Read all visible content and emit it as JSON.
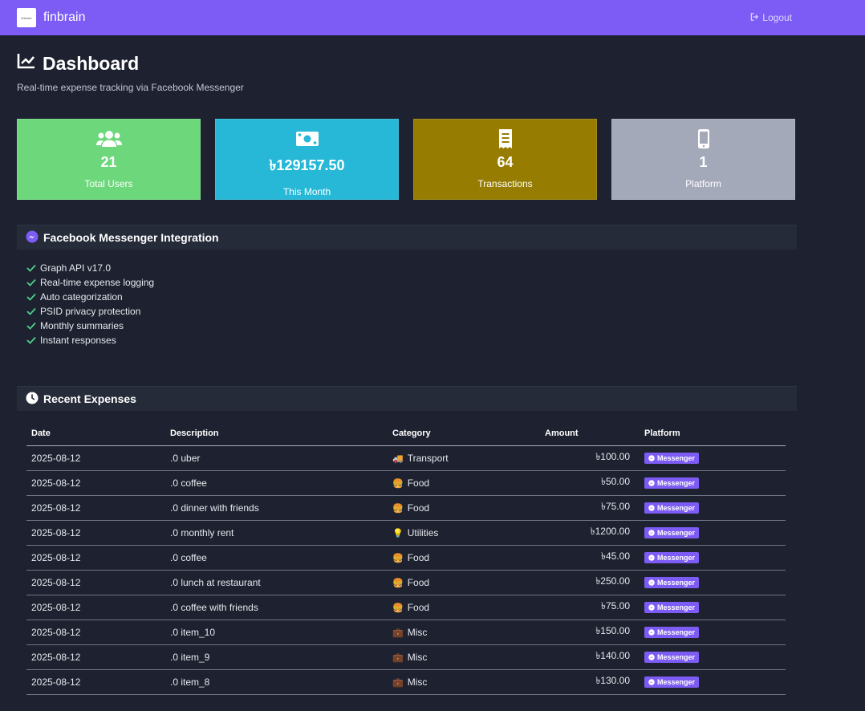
{
  "brand": {
    "logo_text": "finbrain",
    "name": "finbrain"
  },
  "nav": {
    "logout_label": "Logout"
  },
  "page": {
    "title": "Dashboard",
    "subtitle": "Real-time expense tracking via Facebook Messenger"
  },
  "colors": {
    "navbar": "#7c5cf5",
    "users": "#6dd77b",
    "month": "#26b8d6",
    "transactions": "#967c00",
    "platform": "#a4a9ba"
  },
  "stats": [
    {
      "icon": "users-icon",
      "value": "21",
      "label": "Total Users"
    },
    {
      "icon": "money-icon",
      "value": "৳129157.50",
      "label": "This Month"
    },
    {
      "icon": "receipt-icon",
      "value": "64",
      "label": "Transactions"
    },
    {
      "icon": "mobile-icon",
      "value": "1",
      "label": "Platform"
    }
  ],
  "integration": {
    "title": "Facebook Messenger Integration",
    "features": [
      "Graph API v17.0",
      "Real-time expense logging",
      "Auto categorization",
      "PSID privacy protection",
      "Monthly summaries",
      "Instant responses"
    ]
  },
  "expenses": {
    "title": "Recent Expenses",
    "columns": {
      "date": "Date",
      "description": "Description",
      "category": "Category",
      "amount": "Amount",
      "platform": "Platform"
    },
    "rows": [
      {
        "date": "2025-08-12",
        "description": ".0 uber",
        "category_icon": "🚚",
        "category": "Transport",
        "amount": "৳100.00",
        "platform": "Messenger"
      },
      {
        "date": "2025-08-12",
        "description": ".0 coffee",
        "category_icon": "🍔",
        "category": "Food",
        "amount": "৳50.00",
        "platform": "Messenger"
      },
      {
        "date": "2025-08-12",
        "description": ".0 dinner with friends",
        "category_icon": "🍔",
        "category": "Food",
        "amount": "৳75.00",
        "platform": "Messenger"
      },
      {
        "date": "2025-08-12",
        "description": ".0 monthly rent",
        "category_icon": "💡",
        "category": "Utilities",
        "amount": "৳1200.00",
        "platform": "Messenger"
      },
      {
        "date": "2025-08-12",
        "description": ".0 coffee",
        "category_icon": "🍔",
        "category": "Food",
        "amount": "৳45.00",
        "platform": "Messenger"
      },
      {
        "date": "2025-08-12",
        "description": ".0 lunch at restaurant",
        "category_icon": "🍔",
        "category": "Food",
        "amount": "৳250.00",
        "platform": "Messenger"
      },
      {
        "date": "2025-08-12",
        "description": ".0 coffee with friends",
        "category_icon": "🍔",
        "category": "Food",
        "amount": "৳75.00",
        "platform": "Messenger"
      },
      {
        "date": "2025-08-12",
        "description": ".0 item_10",
        "category_icon": "💼",
        "category": "Misc",
        "amount": "৳150.00",
        "platform": "Messenger"
      },
      {
        "date": "2025-08-12",
        "description": ".0 item_9",
        "category_icon": "💼",
        "category": "Misc",
        "amount": "৳140.00",
        "platform": "Messenger"
      },
      {
        "date": "2025-08-12",
        "description": ".0 item_8",
        "category_icon": "💼",
        "category": "Misc",
        "amount": "৳130.00",
        "platform": "Messenger"
      }
    ]
  }
}
